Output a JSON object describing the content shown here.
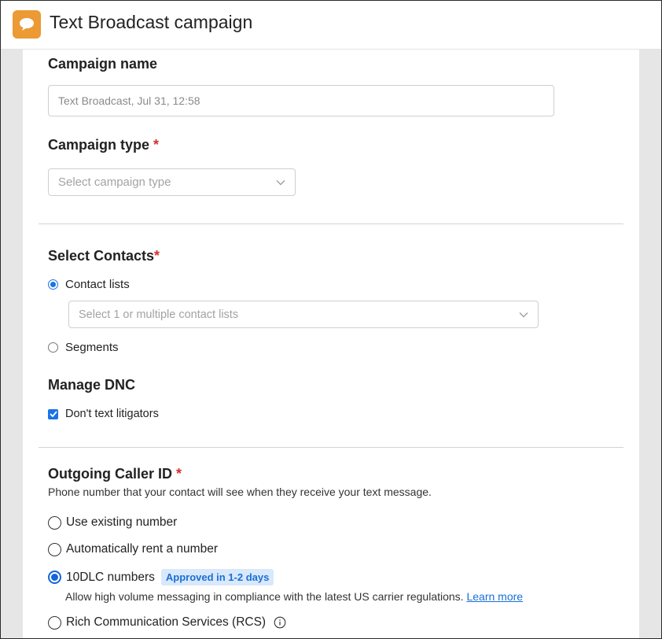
{
  "header": {
    "title": "Text Broadcast campaign",
    "app_icon": "chat-bubble-icon",
    "accent": "#eb9a34"
  },
  "campaign_name": {
    "label": "Campaign name",
    "placeholder": "Text Broadcast, Jul 31, 12:58"
  },
  "campaign_type": {
    "label": "Campaign type",
    "required_mark": "*",
    "placeholder": "Select campaign type"
  },
  "contacts": {
    "label": "Select Contacts",
    "required_mark": "*",
    "options": [
      {
        "label": "Contact lists",
        "selected": true
      },
      {
        "label": "Segments",
        "selected": false
      }
    ],
    "list_select_placeholder": "Select 1 or multiple contact lists"
  },
  "dnc": {
    "label": "Manage DNC",
    "checkbox_label": "Don't text litigators",
    "checked": true
  },
  "caller_id": {
    "label": "Outgoing Caller ID",
    "required_mark": "*",
    "description": "Phone number that your contact will see when they receive your text message.",
    "options": [
      {
        "label": "Use existing number",
        "selected": false
      },
      {
        "label": "Automatically rent a number",
        "selected": false
      },
      {
        "label": "10DLC numbers",
        "selected": true,
        "badge": "Approved in 1-2 days",
        "description": "Allow high volume messaging in compliance with the latest US carrier regulations.",
        "link": "Learn more"
      },
      {
        "label": "Rich Communication Services (RCS)",
        "selected": false,
        "info_icon": "info-icon"
      }
    ]
  }
}
